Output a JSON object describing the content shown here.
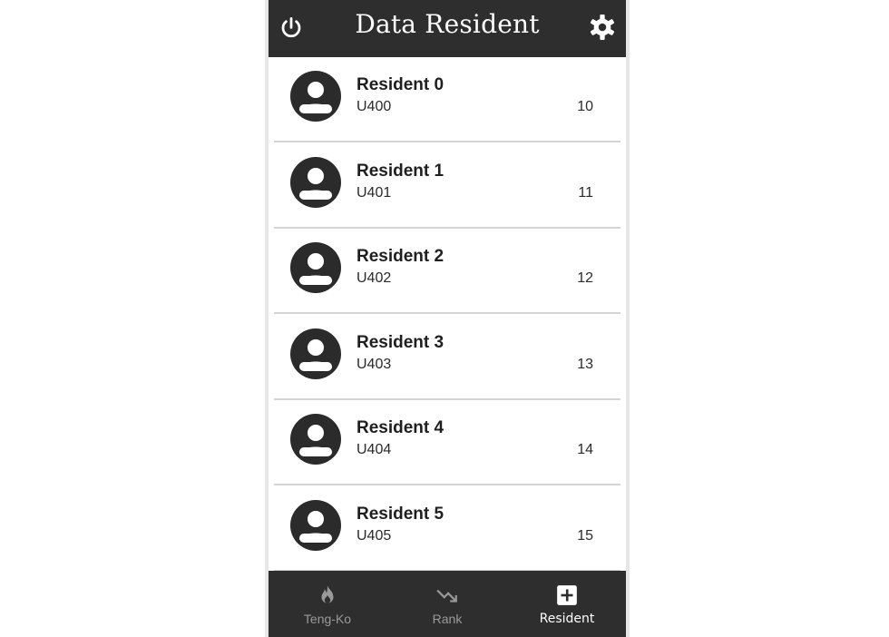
{
  "header": {
    "title": "Data Resident",
    "left_icon": "power-icon",
    "right_icon": "gear-icon"
  },
  "residents": [
    {
      "name": "Resident 0",
      "code": "U400",
      "value": "10"
    },
    {
      "name": "Resident 1",
      "code": "U401",
      "value": "11"
    },
    {
      "name": "Resident 2",
      "code": "U402",
      "value": "12"
    },
    {
      "name": "Resident 3",
      "code": "U403",
      "value": "13"
    },
    {
      "name": "Resident 4",
      "code": "U404",
      "value": "14"
    },
    {
      "name": "Resident 5",
      "code": "U405",
      "value": "15"
    }
  ],
  "bottom_nav": [
    {
      "label": "Teng-Ko",
      "icon": "flame-icon",
      "active": false
    },
    {
      "label": "Rank",
      "icon": "trending-down-icon",
      "active": false
    },
    {
      "label": "Resident",
      "icon": "add-box-icon",
      "active": true
    }
  ],
  "colors": {
    "bar": "#2e2e2e",
    "inactive": "#9a9a9a",
    "active": "#ffffff"
  }
}
